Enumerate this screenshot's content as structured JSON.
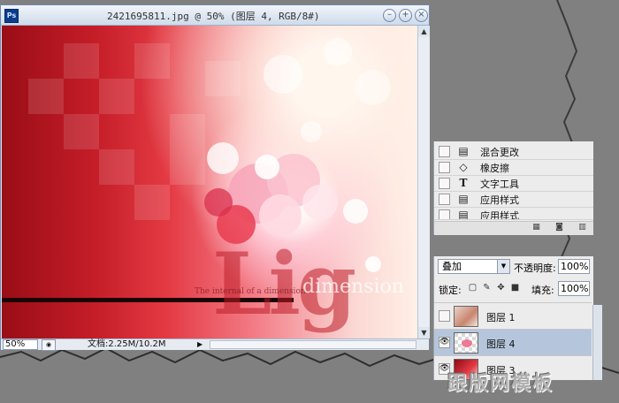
{
  "document": {
    "title": "2421695811.jpg @ 50% (图层 4, RGB/8#)",
    "app_icon_text": "Ps",
    "canvas_text": {
      "big_word": "Lig",
      "tagline": "The internal of a dimension",
      "dimension_word": "dimension"
    },
    "status": {
      "zoom": "50%",
      "doc_info": "文档:2.25M/10.2M"
    }
  },
  "history": {
    "items": [
      {
        "icon": "document-icon",
        "label": "混合更改"
      },
      {
        "icon": "eraser-icon",
        "label": "橡皮擦"
      },
      {
        "icon": "text-tool-icon",
        "label": "文字工具"
      },
      {
        "icon": "document-icon",
        "label": "应用样式"
      },
      {
        "icon": "document-icon",
        "label": "应用样式"
      }
    ]
  },
  "layers": {
    "blend_mode": "叠加",
    "opacity_label": "不透明度:",
    "opacity_value": "100%",
    "lock_label": "锁定:",
    "fill_label": "填充:",
    "fill_value": "100%",
    "items": [
      {
        "name": "图层 1",
        "visible": false,
        "selected": false
      },
      {
        "name": "图层 4",
        "visible": true,
        "selected": true
      },
      {
        "name": "图层 3",
        "visible": true,
        "selected": false
      }
    ]
  },
  "watermark": "跟版网模板",
  "colors": {
    "canvas_dark_red": "#9a0d16",
    "canvas_light": "#fff0e6",
    "selected_layer": "#b5c6dc",
    "window_frame": "#6f8aae"
  }
}
